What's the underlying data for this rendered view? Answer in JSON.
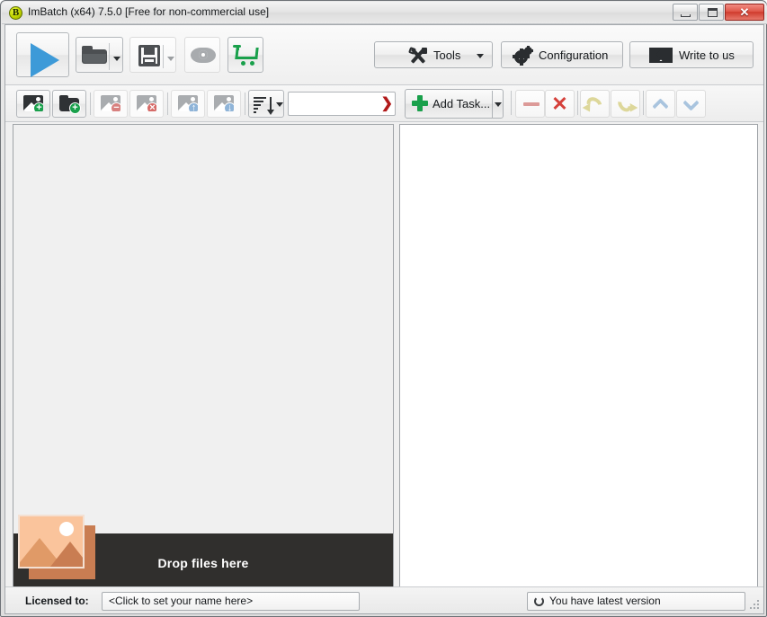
{
  "window": {
    "title": "ImBatch (x64) 7.5.0 [Free for non-commercial use]",
    "logo_letter": "B",
    "controls": {
      "minimize": "Minimize",
      "maximize": "Restore",
      "close": "✕"
    }
  },
  "main_toolbar": {
    "buttons": [
      {
        "name": "run",
        "icon": "play-icon",
        "tooltip": "Run"
      },
      {
        "name": "open",
        "icon": "open-folder-icon",
        "tooltip": "Open"
      },
      {
        "name": "save",
        "icon": "save-floppy-icon",
        "tooltip": "Save"
      },
      {
        "name": "preview",
        "icon": "eye-icon",
        "tooltip": "Preview"
      },
      {
        "name": "buy",
        "icon": "shopping-cart-icon",
        "tooltip": "Buy"
      }
    ],
    "tools_label": "Tools",
    "configuration_label": "Configuration",
    "write_to_us_label": "Write to us"
  },
  "files_toolbar": {
    "buttons": [
      {
        "name": "add-images",
        "icon": "add-image-icon",
        "enabled": true
      },
      {
        "name": "add-folder",
        "icon": "add-folder-icon",
        "enabled": true
      },
      {
        "name": "remove-image",
        "icon": "remove-image-icon",
        "enabled": false
      },
      {
        "name": "clear-images",
        "icon": "delete-image-icon",
        "enabled": false
      },
      {
        "name": "move-image-up",
        "icon": "move-up-image-icon",
        "enabled": false
      },
      {
        "name": "move-image-down",
        "icon": "move-down-image-icon",
        "enabled": false
      },
      {
        "name": "sort",
        "icon": "sort-descending-icon",
        "enabled": true
      }
    ],
    "filter": {
      "value": "",
      "placeholder": "",
      "marker": "❯"
    }
  },
  "tasks_toolbar": {
    "add_task_label": "Add Task...",
    "buttons": [
      {
        "name": "remove-task",
        "icon": "minus-icon",
        "enabled": true
      },
      {
        "name": "delete-all-tasks",
        "icon": "cross-icon",
        "enabled": true
      },
      {
        "name": "undo",
        "icon": "undo-arrow-icon",
        "enabled": false
      },
      {
        "name": "redo",
        "icon": "redo-arrow-icon",
        "enabled": false
      },
      {
        "name": "move-task-up",
        "icon": "chevron-up-icon",
        "enabled": true
      },
      {
        "name": "move-task-down",
        "icon": "chevron-down-icon",
        "enabled": true
      }
    ]
  },
  "panels": {
    "file_list": {
      "items": [],
      "dropzone_text": "Drop files here"
    },
    "task_list": {
      "items": []
    }
  },
  "status_bar": {
    "licensed_to_label": "Licensed to:",
    "licensed_to_value": "<Click to set your name here>",
    "update_status": "You have latest version"
  },
  "colors": {
    "accent_blue": "#3d9ad8",
    "green": "#19a04b",
    "close_red": "#cf3b2d",
    "dropzone_bg": "#302f2d",
    "photo_peach": "#fac49c"
  }
}
